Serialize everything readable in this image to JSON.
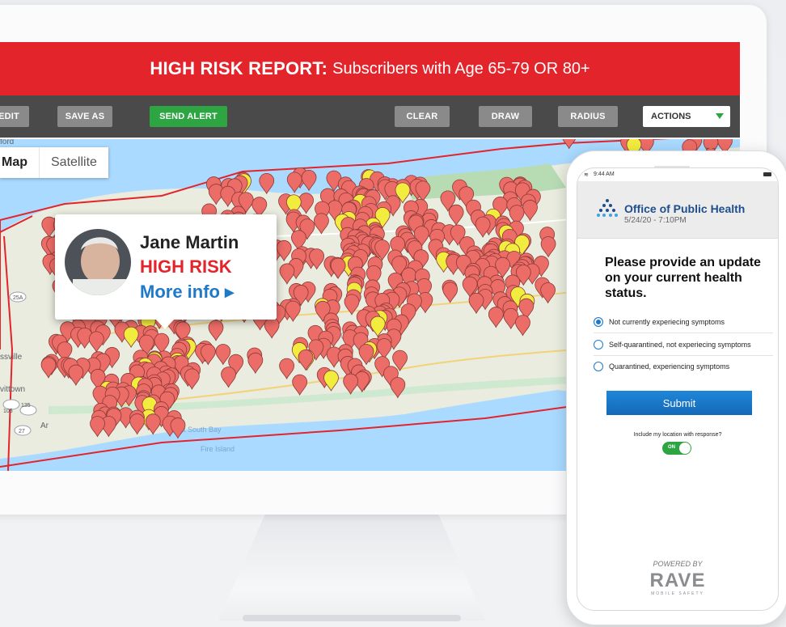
{
  "report": {
    "title_bold": "HIGH RISK REPORT:",
    "title_rest": "Subscribers with Age 65-79 OR 80+"
  },
  "toolbar": {
    "edit": "EDIT",
    "save_as": "SAVE AS",
    "send_alert": "SEND ALERT",
    "clear": "CLEAR",
    "draw": "DRAW",
    "radius": "RADIUS",
    "actions": "ACTIONS"
  },
  "map": {
    "tab_map": "Map",
    "tab_satellite": "Satellite",
    "place_labels": [
      "Great South Bay",
      "Fire Island",
      "ford"
    ],
    "road_shields": [
      "25A",
      "135",
      "105",
      "27",
      "25",
      "27"
    ],
    "town_fragments": [
      "ssville",
      "vittown",
      "Ar"
    ]
  },
  "callout": {
    "name": "Jane Martin",
    "status": "HIGH RISK",
    "more": "More info ▸"
  },
  "phone": {
    "time": "9:44 AM",
    "org": "Office of Public Health",
    "datetime": "5/24/20 - 7:10PM",
    "question": "Please provide an update on your current health status.",
    "options": [
      "Not currently experiecing symptoms",
      "Self-quarantined, not experiecing symptoms",
      "Quarantined, experiencing symptoms"
    ],
    "selected_index": 0,
    "submit": "Submit",
    "location_prompt": "Include my location with response?",
    "toggle": "ON",
    "powered_by": "POWERED BY",
    "brand": "RAVE",
    "brand_sub": "MOBILE SAFETY"
  },
  "colors": {
    "report_red": "#e3242b",
    "toolbar": "#4a4a4a",
    "send_alert_green": "#2ea543",
    "pin_red": "#ec6c67",
    "pin_yellow": "#f2ec3f",
    "water": "#aadaff",
    "land": "#e9ecde"
  }
}
